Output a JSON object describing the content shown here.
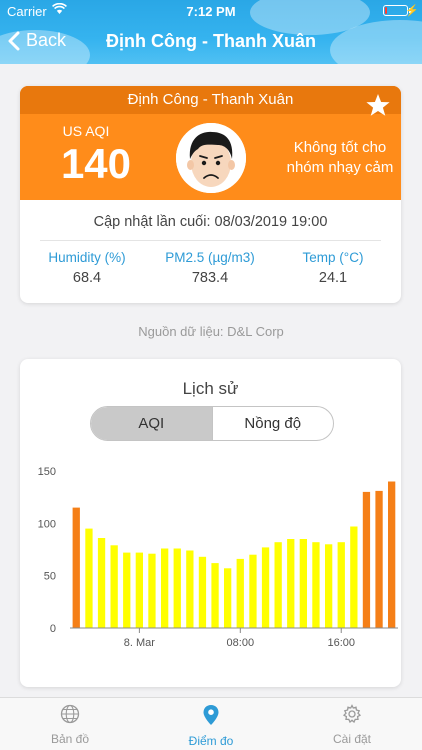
{
  "status_bar": {
    "carrier": "Carrier",
    "time": "7:12 PM",
    "battery_level": 0.1
  },
  "nav": {
    "back_label": "Back",
    "title": "Định Công - Thanh Xuân"
  },
  "aqi_card": {
    "location": "Định Công - Thanh Xuân",
    "aqi_label": "US AQI",
    "aqi_value": "140",
    "status": "Không tốt cho nhóm nhạy cảm",
    "updated": "Cập nhật lần cuối: 08/03/2019 19:00",
    "metrics": [
      {
        "label": "Humidity (%)",
        "value": "68.4"
      },
      {
        "label": "PM2.5 (µg/m3)",
        "value": "783.4"
      },
      {
        "label": "Temp (°C)",
        "value": "24.1"
      }
    ],
    "colors": {
      "orange": "#ff8c1a",
      "orange_dark": "#e8780d",
      "blue": "#2e9bd6"
    }
  },
  "source": "Nguồn dữ liệu: D&L Corp",
  "history": {
    "title": "Lịch sử",
    "segments": [
      "AQI",
      "Nồng độ"
    ],
    "active_segment": "AQI"
  },
  "chart_data": {
    "type": "bar",
    "ylim": [
      0,
      150
    ],
    "yticks": [
      0,
      50,
      100,
      150
    ],
    "xtick_labels": [
      {
        "label": "8. Mar",
        "index": 5.5
      },
      {
        "label": "08:00",
        "index": 13.5
      },
      {
        "label": "16:00",
        "index": 21.5
      }
    ],
    "values": [
      115,
      95,
      86,
      79,
      72,
      72,
      71,
      76,
      76,
      74,
      68,
      62,
      57,
      66,
      70,
      77,
      82,
      85,
      85,
      82,
      80,
      82,
      97,
      130,
      131,
      140
    ],
    "colors": [
      "#f57f17",
      "#ffff00",
      "#ffff00",
      "#ffff00",
      "#ffff00",
      "#ffff00",
      "#ffff00",
      "#ffff00",
      "#ffff00",
      "#ffff00",
      "#ffff00",
      "#ffff00",
      "#ffff00",
      "#ffff00",
      "#ffff00",
      "#ffff00",
      "#ffff00",
      "#ffff00",
      "#ffff00",
      "#ffff00",
      "#ffff00",
      "#ffff00",
      "#ffff00",
      "#f57f17",
      "#f57f17",
      "#f57f17"
    ]
  },
  "tabs": [
    {
      "label": "Bản đồ",
      "icon": "globe-icon",
      "active": false
    },
    {
      "label": "Điểm đo",
      "icon": "map-pin-icon",
      "active": true
    },
    {
      "label": "Cài đặt",
      "icon": "gear-icon",
      "active": false
    }
  ]
}
